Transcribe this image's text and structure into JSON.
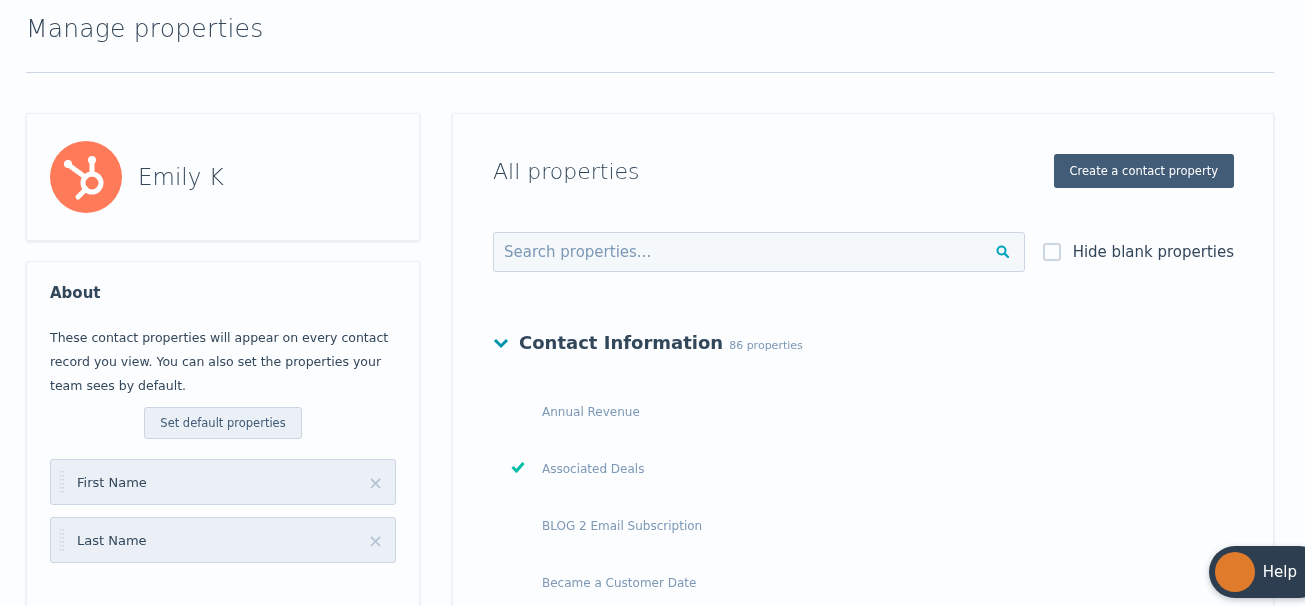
{
  "page": {
    "title": "Manage properties"
  },
  "profile": {
    "name": "Emily K"
  },
  "about": {
    "heading": "About",
    "text": "These contact properties will appear on every contact record you view. You can also set the properties your team sees by default.",
    "button": "Set default properties",
    "fields": [
      {
        "label": "First Name",
        "close": "×"
      },
      {
        "label": "Last Name",
        "close": "×"
      }
    ]
  },
  "properties": {
    "title": "All properties",
    "create_button": "Create a contact property",
    "search": {
      "placeholder": "Search properties..."
    },
    "hide_blank": {
      "label": "Hide blank properties",
      "checked": false
    },
    "group": {
      "name": "Contact Information",
      "count": "86 properties",
      "expanded": true,
      "items": [
        {
          "label": "Annual Revenue",
          "checked": false
        },
        {
          "label": "Associated Deals",
          "checked": true
        },
        {
          "label": "BLOG 2 Email Subscription",
          "checked": false
        },
        {
          "label": "Became a Customer Date",
          "checked": false
        }
      ]
    }
  },
  "help": {
    "label": "Help"
  }
}
